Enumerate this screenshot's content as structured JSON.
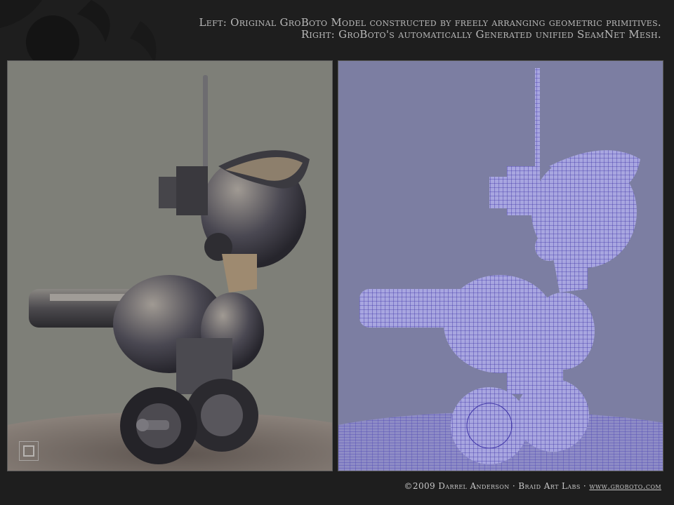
{
  "caption": {
    "line1": "Left: Original GroBoto Model constructed by freely arranging geometric primitives.",
    "line2": "Right: GroBoto's automatically Generated unified SeamNet Mesh."
  },
  "footer": {
    "credit": "©2009 Darrel Anderson · Braid Art Labs · ",
    "link": "www.groboto.com"
  },
  "colors": {
    "left_bg": "#7e7f78",
    "right_bg": "#7c7ea2",
    "wire": "#4a3fb0"
  }
}
